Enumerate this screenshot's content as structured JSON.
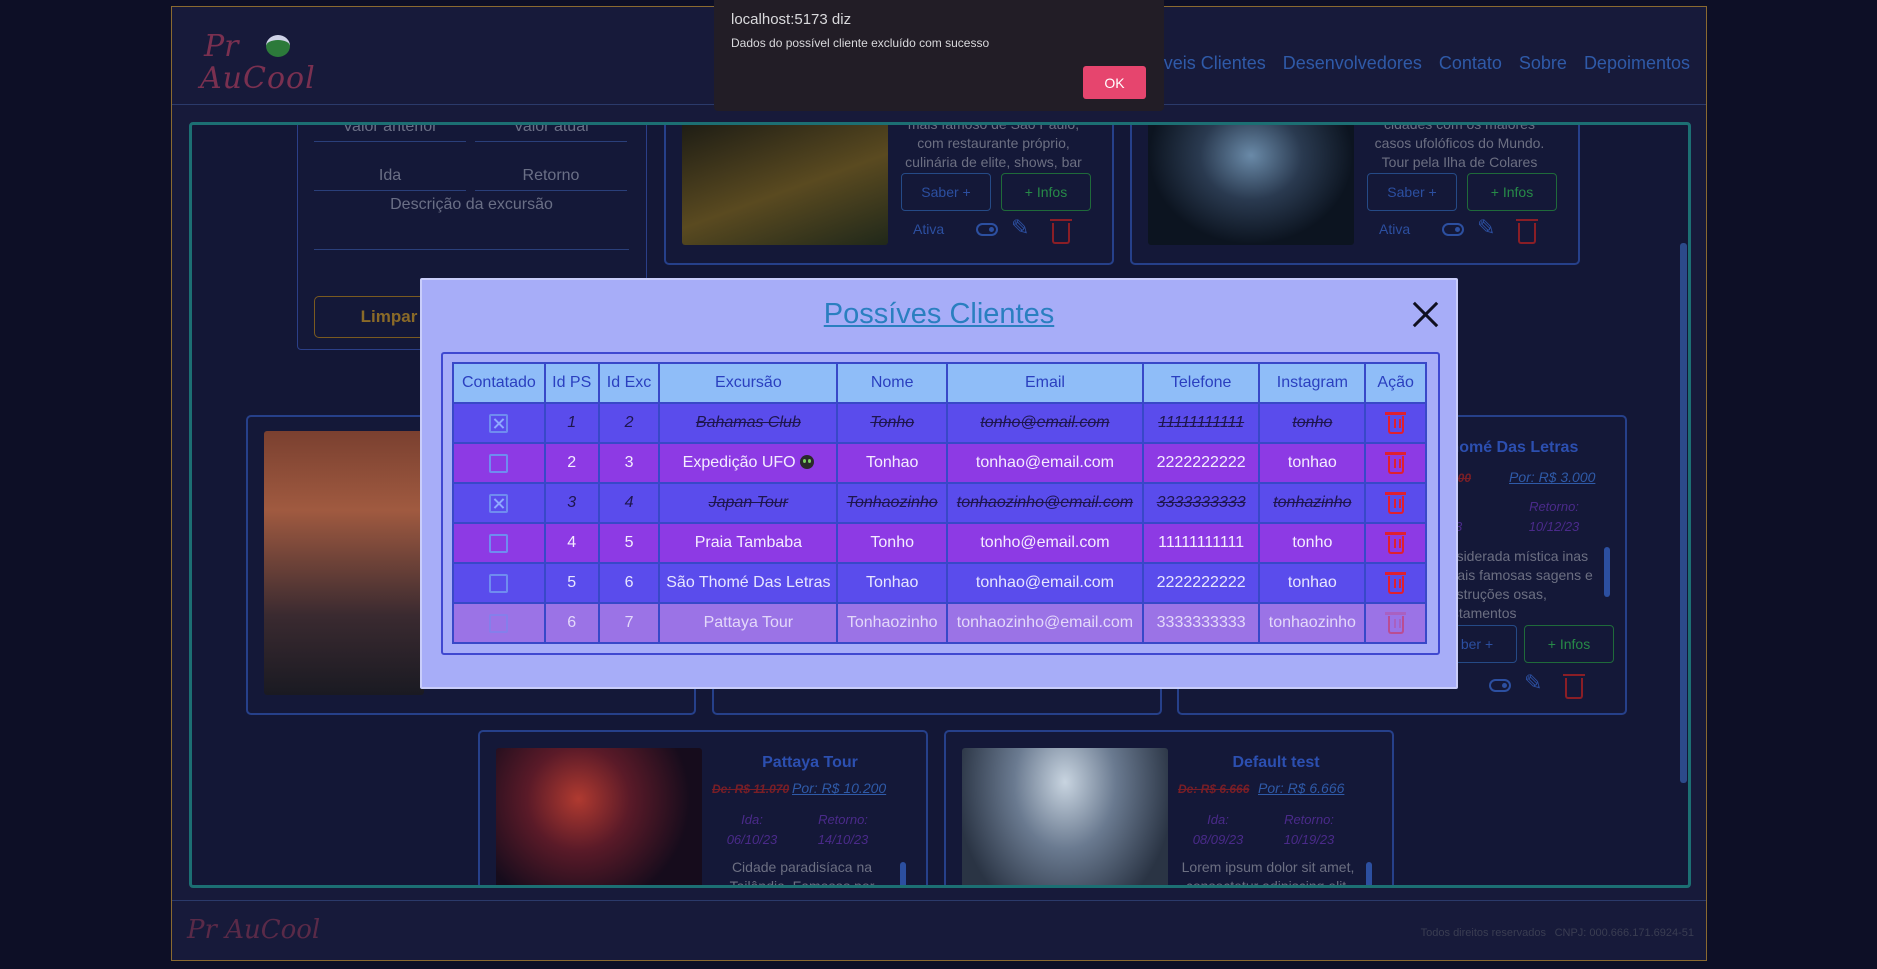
{
  "app": {
    "logo_top": "Pr",
    "logo_bottom": "AuCool",
    "nav": [
      "íveis Clientes",
      "Desenvolvedores",
      "Contato",
      "Sobre",
      "Depoimentos"
    ],
    "footer_logo": "Pr AuCool",
    "footer_rights": "Todos direitos reservados",
    "footer_cnpj": "CNPJ: 000.666.171.6924-51"
  },
  "form": {
    "valor_anterior": "Valor anterior",
    "valor_atual": "Valor atual",
    "ida": "Ida",
    "retorno": "Retorno",
    "descricao": "Descrição da excursão",
    "limpar": "Limpar"
  },
  "cards": {
    "top1": {
      "text": "mais famoso de São Paulo, com restaurante próprio, culinária de elite, shows, bar",
      "saber": "Saber +",
      "infos": "+ Infos",
      "ativa": "Ativa"
    },
    "top2": {
      "text": "cidades com os maiores casos ufolóficos do Mundo. Tour pela Ilha de Colares",
      "saber": "Saber +",
      "infos": "+ Infos",
      "ativa": "Ativa"
    },
    "right": {
      "title": "Thomé Das Letras",
      "de": "4.100",
      "por": "Por: R$ 3.000",
      "ida": "23",
      "ret_label": "Retorno:",
      "ret": "10/12/23",
      "text": "considerada mística inas Gerais famosas sagens e construções osas, avistamentos",
      "saber": "ber +",
      "infos": "+ Infos"
    },
    "pattaya": {
      "title": "Pattaya Tour",
      "de": "De: R$ 11.070",
      "por": "Por: R$ 10.200",
      "ida_label": "Ida:",
      "ida": "06/10/23",
      "ret_label": "Retorno:",
      "ret": "14/10/23",
      "text": "Cidade paradisíaca na Tailândia. Famosas por"
    },
    "default": {
      "title": "Default test",
      "de": "De: R$ 6.666",
      "por": "Por: R$ 6.666",
      "ida_label": "Ida:",
      "ida": "08/09/23",
      "ret_label": "Retorno:",
      "ret": "10/19/23",
      "text": "Lorem ipsum dolor sit amet, consectetur adipiscing elit."
    }
  },
  "modal": {
    "title": "Possíves Clientes",
    "columns": [
      "Contatado",
      "Id PS",
      "Id Exc",
      "Excursão",
      "Nome",
      "Email",
      "Telefone",
      "Instagram",
      "Ação"
    ],
    "rows": [
      {
        "contatado": true,
        "id_ps": "1",
        "id_exc": "2",
        "excursao": "Bahamas Club",
        "nome": "Tonho",
        "email": "tonho@email.com",
        "telefone": "11111111111",
        "instagram": "tonho"
      },
      {
        "contatado": false,
        "id_ps": "2",
        "id_exc": "3",
        "excursao": "Expedição UFO",
        "nome": "Tonhao",
        "email": "tonhao@email.com",
        "telefone": "2222222222",
        "instagram": "tonhao"
      },
      {
        "contatado": true,
        "id_ps": "3",
        "id_exc": "4",
        "excursao": "Japan Tour",
        "nome": "Tonhaozinho",
        "email": "tonhaozinho@email.com",
        "telefone": "3333333333",
        "instagram": "tonhazinho"
      },
      {
        "contatado": false,
        "id_ps": "4",
        "id_exc": "5",
        "excursao": "Praia Tambaba",
        "nome": "Tonho",
        "email": "tonho@email.com",
        "telefone": "11111111111",
        "instagram": "tonho"
      },
      {
        "contatado": false,
        "id_ps": "5",
        "id_exc": "6",
        "excursao": "São Thomé Das Letras",
        "nome": "Tonhao",
        "email": "tonhao@email.com",
        "telefone": "2222222222",
        "instagram": "tonhao"
      },
      {
        "contatado": false,
        "id_ps": "6",
        "id_exc": "7",
        "excursao": "Pattaya Tour",
        "nome": "Tonhaozinho",
        "email": "tonhaozinho@email.com",
        "telefone": "3333333333",
        "instagram": "tonhaozinho"
      }
    ]
  },
  "alert": {
    "origin": "localhost:5173 diz",
    "message": "Dados do possível cliente excluído com sucesso",
    "ok_label": "OK"
  },
  "colors": {
    "modal_bg": "#a7adf8",
    "row_blue": "#5a4cec",
    "row_purple": "#8d3ae4",
    "header": "#8fbdf8",
    "delete": "#e02030",
    "alert_ok": "#e6456e"
  }
}
